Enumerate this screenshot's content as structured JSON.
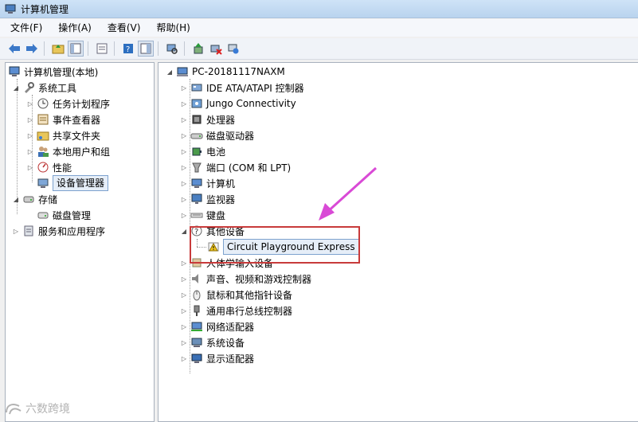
{
  "window": {
    "title": "计算机管理"
  },
  "menu": [
    "文件(F)",
    "操作(A)",
    "查看(V)",
    "帮助(H)"
  ],
  "left_tree": {
    "root": "计算机管理(本地)",
    "system_tools": "系统工具",
    "items": [
      "任务计划程序",
      "事件查看器",
      "共享文件夹",
      "本地用户和组",
      "性能",
      "设备管理器"
    ],
    "storage": "存储",
    "disk": "磁盘管理",
    "services": "服务和应用程序"
  },
  "device_tree": {
    "root": "PC-20181117NAXM",
    "categories": [
      "IDE ATA/ATAPI 控制器",
      "Jungo Connectivity",
      "处理器",
      "磁盘驱动器",
      "电池",
      "端口 (COM 和 LPT)",
      "计算机",
      "监视器",
      "键盘",
      "其他设备",
      "人体学输入设备",
      "声音、视频和游戏控制器",
      "鼠标和其他指针设备",
      "通用串行总线控制器",
      "网络适配器",
      "系统设备",
      "显示适配器"
    ],
    "other_device_child": "Circuit Playground Express"
  },
  "annotation": {
    "color": "#c83b3b",
    "arrow_color": "#d94ad6"
  },
  "watermark": "六数跨境"
}
